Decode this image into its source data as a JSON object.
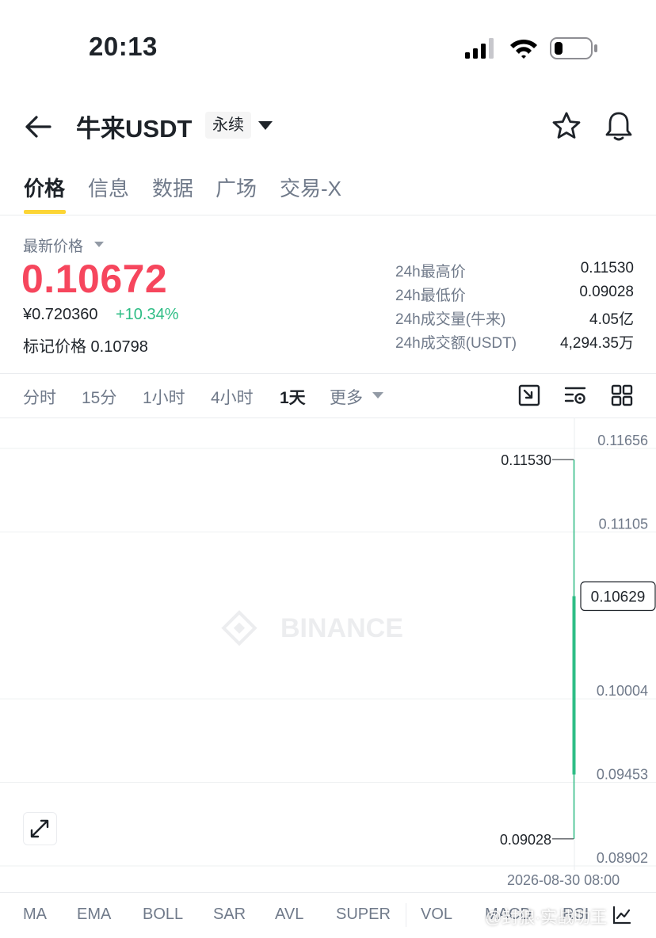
{
  "status_bar": {
    "time": "20:13"
  },
  "header": {
    "pair": "牛来USDT",
    "contract_type": "永续",
    "icons": [
      "back-arrow-icon",
      "caret-down-icon",
      "star-icon",
      "bell-icon"
    ]
  },
  "tabs": [
    {
      "label": "价格",
      "active": true
    },
    {
      "label": "信息"
    },
    {
      "label": "数据"
    },
    {
      "label": "广场"
    },
    {
      "label": "交易-X"
    }
  ],
  "price": {
    "latest_label": "最新价格",
    "last_price": "0.10672",
    "cny_price": "¥0.720360",
    "change_pct": "+10.34%",
    "mark_price_label": "标记价格 0.10798"
  },
  "stats": [
    {
      "label": "24h最高价",
      "value": "0.11530"
    },
    {
      "label": "24h最低价",
      "value": "0.09028"
    },
    {
      "label": "24h成交量(牛来)",
      "value": "4.05亿"
    },
    {
      "label": "24h成交额(USDT)",
      "value": "4,294.35万"
    }
  ],
  "intervals": [
    {
      "label": "分时"
    },
    {
      "label": "15分"
    },
    {
      "label": "1小时"
    },
    {
      "label": "4小时"
    },
    {
      "label": "1天",
      "active": true
    },
    {
      "label": "更多"
    }
  ],
  "chart": {
    "watermark": "BINANCE",
    "y_axis_labels": [
      "0.11656",
      "0.11105",
      "0.10629",
      "0.10004",
      "0.09453",
      "0.08902"
    ],
    "current_price_tag": "0.10629",
    "high_marker": "0.11530",
    "low_marker": "0.09028",
    "candle": {
      "open": 0.09453,
      "high": 0.1153,
      "low": 0.09028,
      "close": 0.10629
    },
    "y_range": [
      0.08902,
      0.11656
    ],
    "date_label": "2026-08-30 08:00",
    "colors": {
      "up": "#2ebd85",
      "down": "#f6465d",
      "accent": "#fcd535"
    }
  },
  "indicators": [
    "MA",
    "EMA",
    "BOLL",
    "SAR",
    "AVL",
    "SUPER",
    "VOL",
    "MACD",
    "RSI"
  ],
  "overlay_watermark": "@封狼·实战叻王"
}
